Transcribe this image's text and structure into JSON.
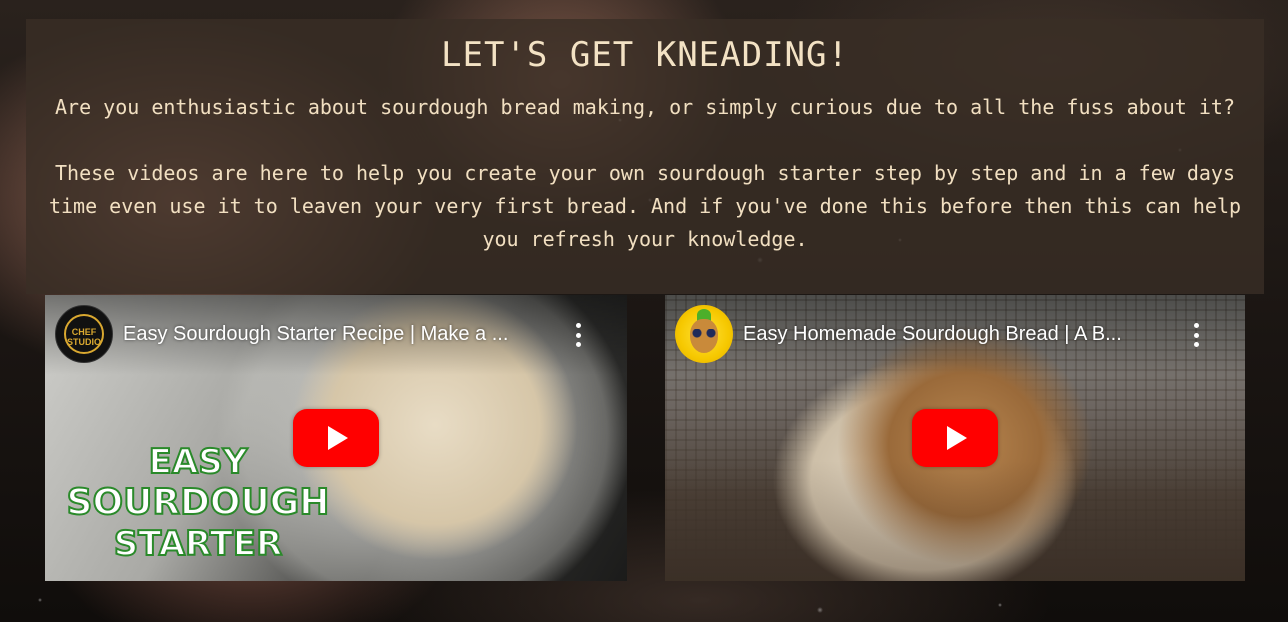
{
  "intro": {
    "heading": "LET'S GET KNEADING!",
    "paragraph_1": "Are you enthusiastic about sourdough bread making, or simply curious due to all the fuss about it?",
    "paragraph_2": "These videos are here to help you create your own sourdough starter step by step and in a few days time even use it to leaven your very first bread. And if you've done this before then this can help you refresh your knowledge."
  },
  "videos": [
    {
      "title": "Easy Sourdough Starter Recipe | Make a ...",
      "channel_logo_text": "CHEF STUDIO",
      "thumbnail_text": [
        "EASY",
        "SOURDOUGH",
        "STARTER"
      ],
      "play_icon": "youtube-play-icon",
      "menu_icon": "more-vert-icon"
    },
    {
      "title": "Easy Homemade Sourdough Bread | A B...",
      "play_icon": "youtube-play-icon",
      "menu_icon": "more-vert-icon"
    }
  ],
  "colors": {
    "panel_bg": "#3a2e26",
    "text": "#f1dfc1",
    "play_red": "#ff0000"
  }
}
